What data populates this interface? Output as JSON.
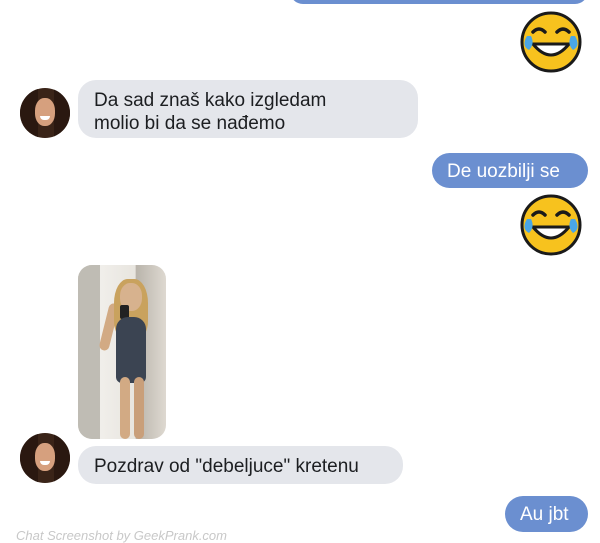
{
  "messages": [
    {
      "side": "in",
      "text_line1": "Da sad znaš kako izgledam",
      "text_line2": "molio bi da se nađemo"
    },
    {
      "side": "out",
      "text": "De uozbilji se"
    },
    {
      "side": "in",
      "text": "Pozdrav od \"debeljuce\" kretenu"
    },
    {
      "side": "out",
      "text": "Au jbt"
    }
  ],
  "emoji": {
    "name": "face-with-tears-of-joy-icon"
  },
  "watermark": "Chat Screenshot by GeekPrank.com",
  "colors": {
    "incoming_bubble": "#e4e6eb",
    "outgoing_bubble": "#6b8fd0",
    "background": "#ffffff"
  }
}
